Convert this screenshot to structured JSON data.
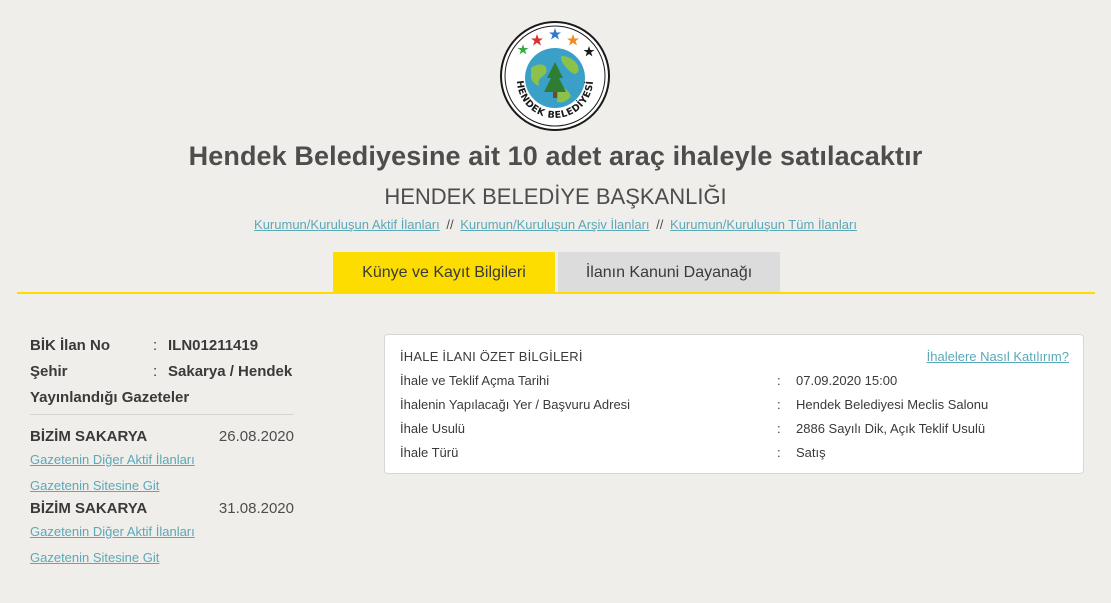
{
  "logo": {
    "text": "HENDEK BELEDİYESİ",
    "colors": {
      "ring": "#1a1a1a",
      "globe": "#3aa0c8",
      "land": "#8cc24a",
      "tree": "#2e7d32",
      "star_red": "#d6332a",
      "star_blue": "#2b7bd0",
      "star_green": "#3aa845",
      "star_orange": "#f08a24"
    }
  },
  "header": {
    "title": "Hendek Belediyesine ait 10 adet araç ihaleyle satılacaktır",
    "subtitle": "HENDEK BELEDİYE BAŞKANLIĞI",
    "links": [
      "Kurumun/Kuruluşun Aktif İlanları",
      "Kurumun/Kuruluşun Arşiv İlanları",
      "Kurumun/Kuruluşun Tüm İlanları"
    ],
    "link_separator": "//"
  },
  "tabs": [
    {
      "label": "Künye ve Kayıt Bilgileri",
      "active": true
    },
    {
      "label": "İlanın Kanuni Dayanağı",
      "active": false
    }
  ],
  "accent_color": "#fddc00",
  "link_color": "#5aa8b8",
  "info": {
    "bik_label": "BİK İlan No",
    "bik_value": "ILN01211419",
    "sehir_label": "Şehir",
    "sehir_value": "Sakarya / Hendek",
    "colon": ":",
    "gazeteler_label": "Yayınlandığı Gazeteler"
  },
  "papers": [
    {
      "name": "BİZİM SAKARYA",
      "date": "26.08.2020",
      "other_link": "Gazetenin Diğer Aktif İlanları",
      "site_link": "Gazetenin Sitesine Git"
    },
    {
      "name": "BİZİM SAKARYA",
      "date": "31.08.2020",
      "other_link": "Gazetenin Diğer Aktif İlanları",
      "site_link": "Gazetenin Sitesine Git"
    }
  ],
  "summary": {
    "title": "İHALE İLANI ÖZET BİLGİLERİ",
    "help_link": "İhalelere Nasıl Katılırım?",
    "rows": [
      {
        "label": "İhale ve Teklif Açma Tarihi",
        "value": "07.09.2020 15:00"
      },
      {
        "label": "İhalenin Yapılacağı Yer / Başvuru Adresi",
        "value": "Hendek Belediyesi Meclis Salonu"
      },
      {
        "label": "İhale Usulü",
        "value": "2886 Sayılı Dik, Açık Teklif Usulü"
      },
      {
        "label": "İhale Türü",
        "value": "Satış"
      }
    ]
  }
}
